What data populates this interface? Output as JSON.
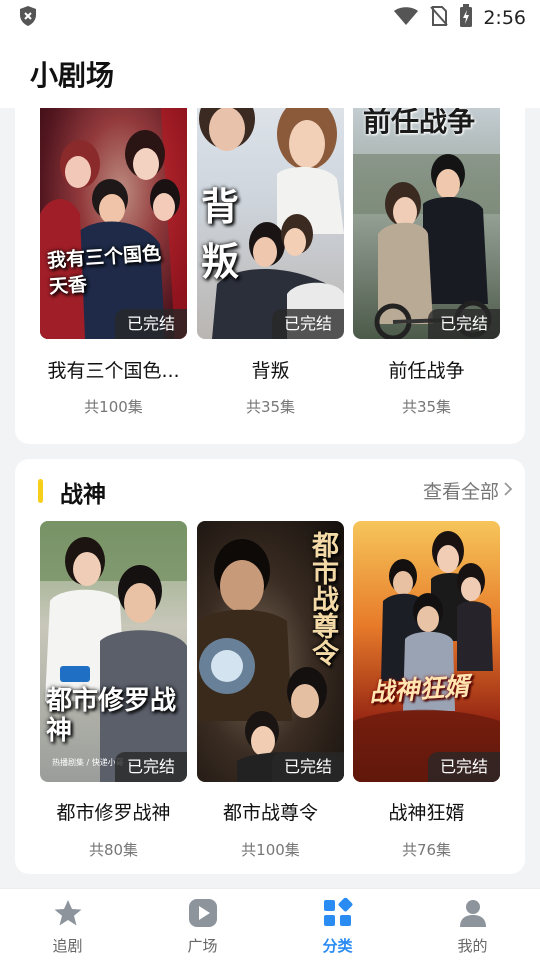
{
  "status_bar": {
    "time": "2:56",
    "icons": [
      "shield-icon",
      "wifi-icon",
      "no-sim-icon",
      "battery-charging-icon"
    ]
  },
  "header": {
    "title": "小剧场"
  },
  "sections": [
    {
      "title": "",
      "items": [
        {
          "title": "我有三个国色...",
          "episodes": "共100集",
          "badge": "已完结",
          "poster_text": "我有三个国色天香"
        },
        {
          "title": "背叛",
          "episodes": "共35集",
          "badge": "已完结",
          "poster_text": "背 叛"
        },
        {
          "title": "前任战争",
          "episodes": "共35集",
          "badge": "已完结",
          "poster_text": "前任战争"
        }
      ]
    },
    {
      "title": "战神",
      "see_all": "查看全部",
      "items": [
        {
          "title": "都市修罗战神",
          "episodes": "共80集",
          "badge": "已完结",
          "poster_text": "都市修罗战神",
          "poster_small": "热播剧集 / 快递小哥"
        },
        {
          "title": "都市战尊令",
          "episodes": "共100集",
          "badge": "已完结",
          "poster_text": "都市战尊令"
        },
        {
          "title": "战神狂婿",
          "episodes": "共76集",
          "badge": "已完结",
          "poster_text": "战神狂婿"
        }
      ]
    }
  ],
  "bottom_nav": [
    {
      "label": "追剧",
      "icon": "star-icon",
      "active": false
    },
    {
      "label": "广场",
      "icon": "play-icon",
      "active": false
    },
    {
      "label": "分类",
      "icon": "category-grid-icon",
      "active": true
    },
    {
      "label": "我的",
      "icon": "person-icon",
      "active": false
    }
  ],
  "colors": {
    "accent": "#2a8cf2",
    "section_bar": "#f6cf1b",
    "background": "#f2f3f5"
  }
}
